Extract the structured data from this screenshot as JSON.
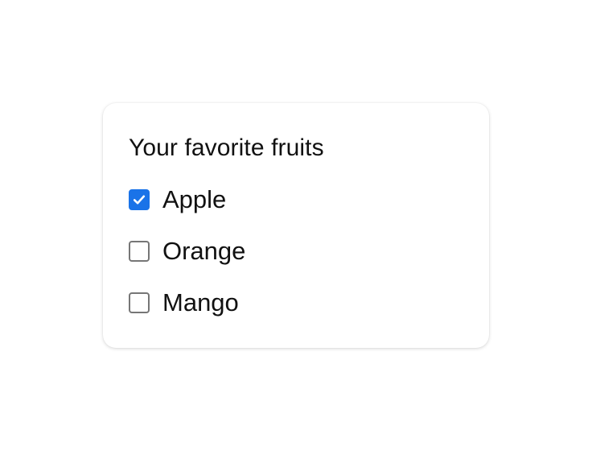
{
  "fieldset": {
    "legend": "Your favorite fruits",
    "options": [
      {
        "label": "Apple",
        "checked": true
      },
      {
        "label": "Orange",
        "checked": false
      },
      {
        "label": "Mango",
        "checked": false
      }
    ]
  },
  "colors": {
    "checked_fill": "#1a73e8",
    "unchecked_border": "#767676",
    "text": "#111111"
  }
}
